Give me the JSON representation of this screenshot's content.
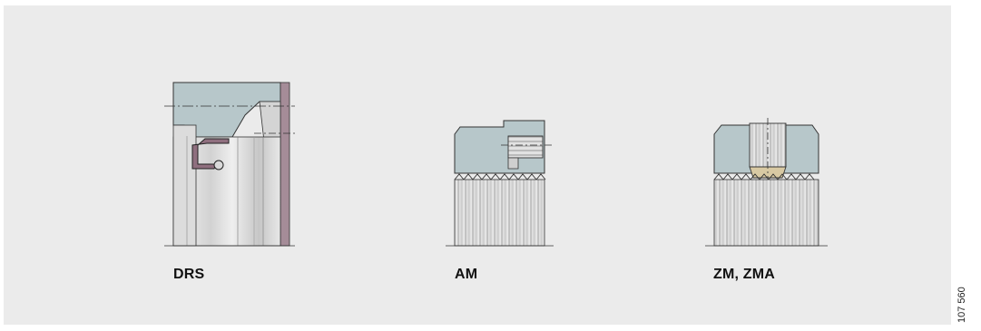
{
  "captions": {
    "drs": "DRS",
    "am": "AM",
    "zm": "ZM, ZMA"
  },
  "drawing_number": "107 560",
  "colors": {
    "panel": "#ebebeb",
    "section": "#b7c7ca",
    "metal_light": "#e6e6e6",
    "metal_mid": "#c8c8c8",
    "seal": "#8f6f7f",
    "brass": "#d8c9a3",
    "outline": "#333333"
  },
  "icons": [
    "seal-profile",
    "set-screw",
    "threaded-pin"
  ]
}
